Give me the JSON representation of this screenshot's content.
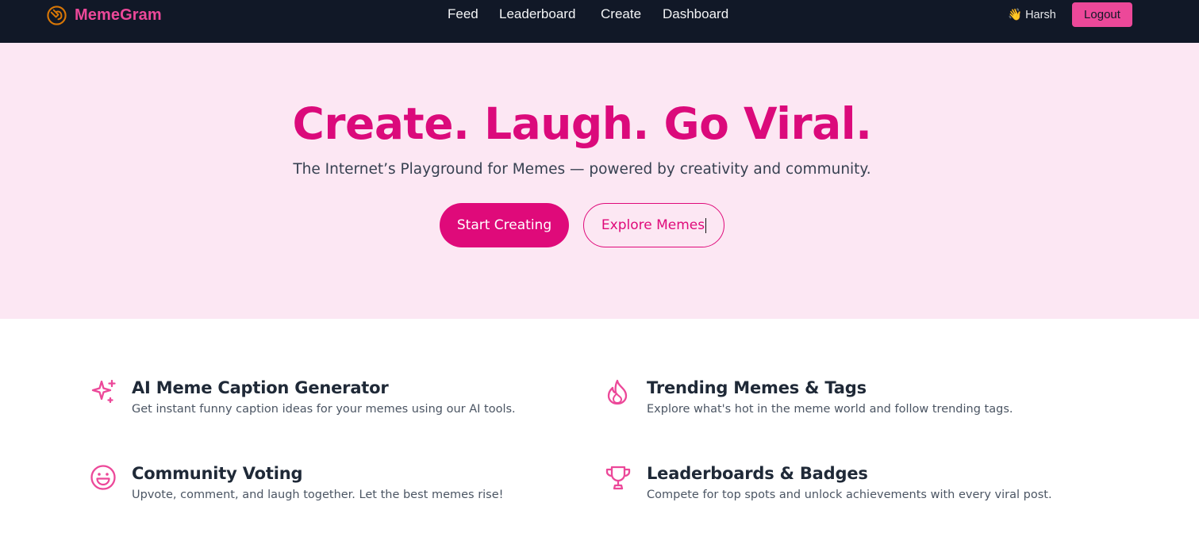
{
  "brand": {
    "name": "MemeGram",
    "icon": "meme-logo-icon"
  },
  "nav": {
    "links": [
      {
        "label": "Feed"
      },
      {
        "label": "Leaderboard"
      },
      {
        "label": "Create"
      },
      {
        "label": "Dashboard"
      }
    ],
    "user": "👋 Harsh",
    "logout_label": "Logout"
  },
  "hero": {
    "title": "Create. Laugh. Go Viral.",
    "subtitle": "The Internet’s Playground for Memes — powered by creativity and community.",
    "primary_cta": "Start Creating",
    "secondary_cta": "Explore Memes"
  },
  "features": [
    {
      "icon": "sparkles-icon",
      "title": "AI Meme Caption Generator",
      "description": "Get instant funny caption ideas for your memes using our AI tools."
    },
    {
      "icon": "fire-icon",
      "title": "Trending Memes & Tags",
      "description": "Explore what's hot in the meme world and follow trending tags."
    },
    {
      "icon": "smiley-icon",
      "title": "Community Voting",
      "description": "Upvote, comment, and laugh together. Let the best memes rise!"
    },
    {
      "icon": "trophy-icon",
      "title": "Leaderboards & Badges",
      "description": "Compete for top spots and unlock achievements with every viral post."
    }
  ],
  "colors": {
    "nav_bg": "#111827",
    "accent": "#ec4899",
    "hero_bg": "#fce7f3",
    "hero_title": "#db0a7b"
  }
}
